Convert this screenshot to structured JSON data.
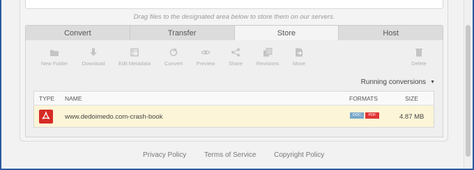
{
  "upload": {
    "hint": "Drag files to the designated area below to store them on our servers."
  },
  "tabs": [
    {
      "label": "Convert",
      "active": false
    },
    {
      "label": "Transfer",
      "active": false
    },
    {
      "label": "Store",
      "active": true
    },
    {
      "label": "Host",
      "active": false
    }
  ],
  "toolbar": {
    "new_folder": "New Folder",
    "download": "Download",
    "edit_metadata": "Edit Metadata",
    "convert": "Convert",
    "preview": "Preview",
    "share": "Share",
    "revisions": "Revisions",
    "move": "Move",
    "delete": "Delete"
  },
  "running_conversions": "Running conversions",
  "table": {
    "headers": {
      "type": "TYPE",
      "name": "NAME",
      "formats": "FORMATS",
      "size": "SIZE"
    },
    "rows": [
      {
        "type_icon": "pdf-icon",
        "name": "www.dedoimedo.com-crash-book",
        "formats": [
          "DOC",
          "PDF"
        ],
        "size": "4.87 MB"
      }
    ]
  },
  "footer": {
    "privacy": "Privacy Policy",
    "terms": "Terms of Service",
    "copyright": "Copyright Policy"
  },
  "colors": {
    "frame_accent": "#2c5aa0",
    "row_highlight": "#fcf5d8",
    "pdf_red": "#d62b25",
    "doc_blue": "#7aa8c9"
  }
}
